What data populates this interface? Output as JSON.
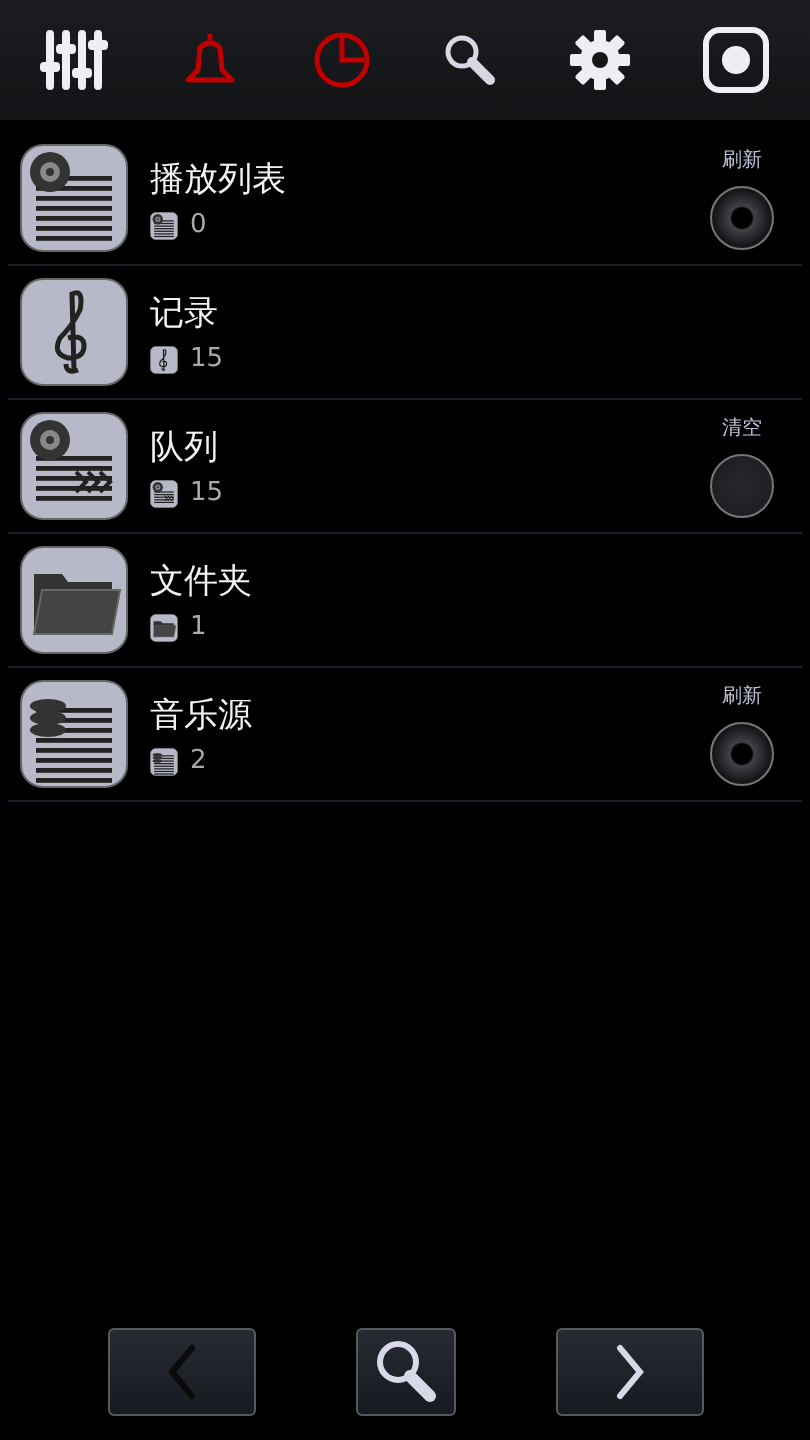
{
  "toolbar": [
    {
      "kind": "equalizer",
      "color": "#eeeef4"
    },
    {
      "kind": "bell",
      "color": "#c00000"
    },
    {
      "kind": "clock",
      "color": "#c00000"
    },
    {
      "kind": "search",
      "color": "#d8d8e4"
    },
    {
      "kind": "gear",
      "color": "#eeeef4"
    },
    {
      "kind": "record",
      "color": "#eeeef4"
    }
  ],
  "rows": [
    {
      "kind": "playlist",
      "title": "播放列表",
      "count": "0",
      "action": {
        "label": "刷新",
        "kind": "refresh"
      }
    },
    {
      "kind": "clef",
      "title": "记录",
      "count": "15"
    },
    {
      "kind": "queue",
      "title": "队列",
      "count": "15",
      "action": {
        "label": "清空",
        "kind": "clear"
      }
    },
    {
      "kind": "folder",
      "title": "文件夹",
      "count": "1"
    },
    {
      "kind": "source",
      "title": "音乐源",
      "count": "2",
      "action": {
        "label": "刷新",
        "kind": "refresh"
      }
    }
  ],
  "nav": [
    {
      "kind": "back",
      "disabled": true
    },
    {
      "kind": "search",
      "disabled": false
    },
    {
      "kind": "forward",
      "disabled": false
    }
  ]
}
